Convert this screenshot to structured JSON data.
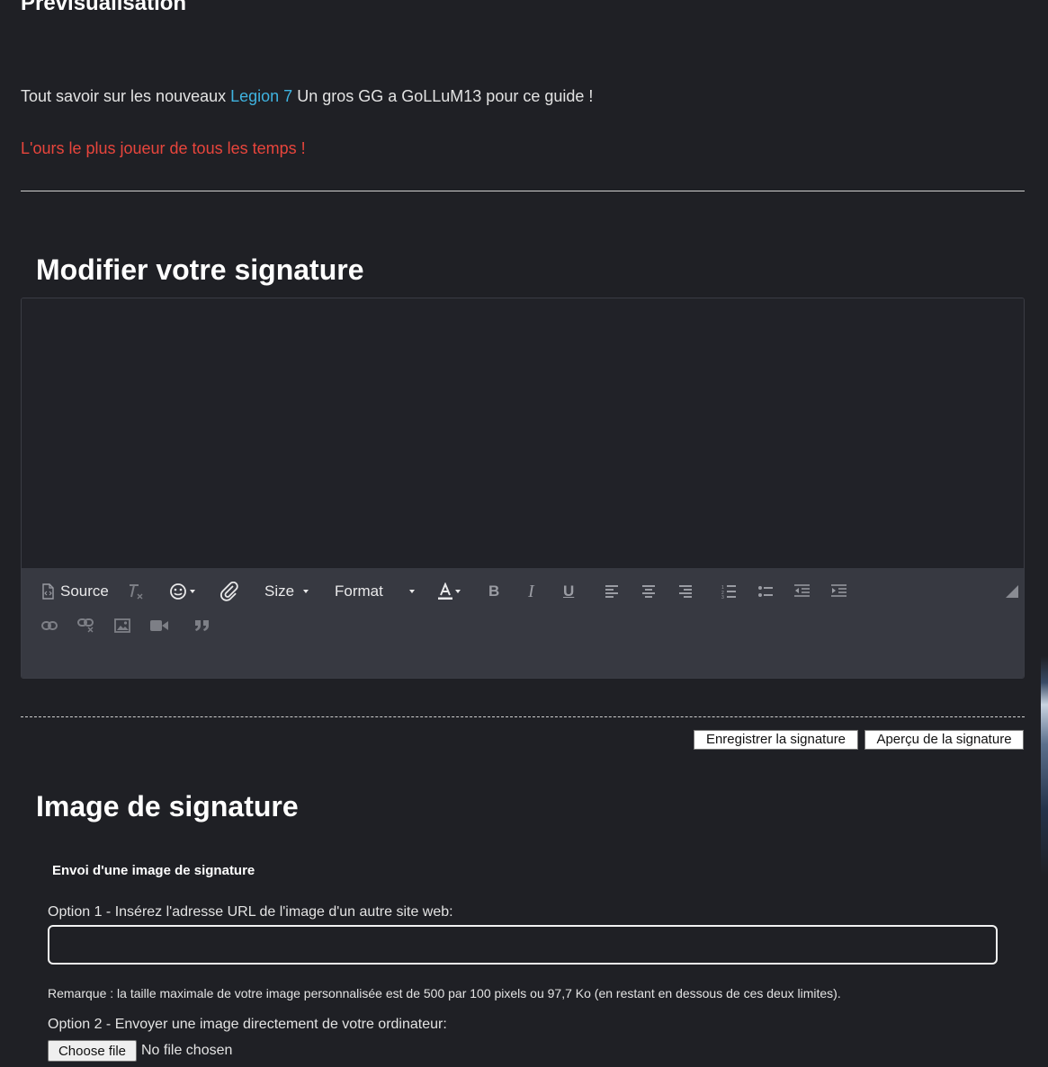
{
  "preview": {
    "heading": "Prévisualisation",
    "line1_before": "Tout savoir sur les nouveaux ",
    "line1_link": "Legion 7",
    "line1_after": " Un gros GG a GoLLuM13 pour ce guide !",
    "line2": "L'ours le plus joueur de tous les temps !"
  },
  "signature_section": {
    "title": "Modifier votre signature",
    "editor_value": "",
    "toolbar": {
      "source_label": "Source",
      "size_label": "Size",
      "format_label": "Format",
      "icons": [
        "source-icon",
        "remove-format-icon",
        "smiley-icon",
        "attachment-icon",
        "text-color-icon",
        "bold-icon",
        "italic-icon",
        "underline-icon",
        "align-left-icon",
        "align-center-icon",
        "align-right-icon",
        "numbered-list-icon",
        "bulleted-list-icon",
        "outdent-icon",
        "indent-icon",
        "link-icon",
        "unlink-icon",
        "image-icon",
        "video-icon",
        "quote-icon",
        "resize-icon"
      ]
    },
    "save_button": "Enregistrer la signature",
    "preview_button": "Aperçu de la signature"
  },
  "image_section": {
    "title": "Image de signature",
    "subheading": "Envoi d'une image de signature",
    "option1_label": "Option 1 - Insérez l'adresse URL de l'image d'un autre site web:",
    "url_value": "",
    "remark": "Remarque : la taille maximale de votre image personnalisée est de 500 par 100 pixels ou 97,7 Ko (en restant en dessous de ces deux limites).",
    "option2_label": "Option 2 - Envoyer une image directement de votre ordinateur:",
    "file_button": "Choose file",
    "file_status": "No file chosen"
  },
  "colors": {
    "background": "#1f2025",
    "toolbar": "#373941",
    "link": "#3fb3e0",
    "alert": "#e8453c"
  }
}
